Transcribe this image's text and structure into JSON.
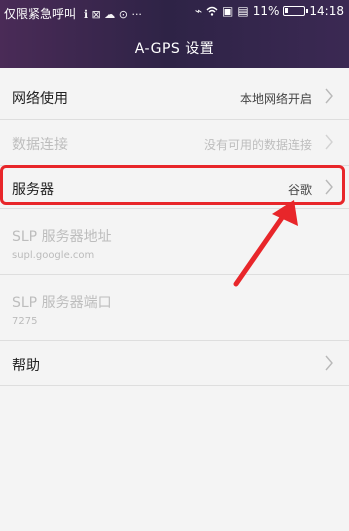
{
  "statusbar": {
    "carrier": "仅限紧急呼叫",
    "battery_percent": "11%",
    "time": "14:18",
    "icons": [
      "sync-icon",
      "image-icon",
      "cloud-icon",
      "robot-icon",
      "more-icon",
      "vibrate-icon",
      "wifi-icon",
      "sim-icon",
      "screenshot-icon"
    ]
  },
  "header": {
    "title": "A-GPS 设置"
  },
  "rows": {
    "network": {
      "label": "网络使用",
      "value": "本地网络开启"
    },
    "data": {
      "label": "数据连接",
      "value": "没有可用的数据连接"
    },
    "server": {
      "label": "服务器",
      "value": "谷歌"
    },
    "slp_address": {
      "label": "SLP 服务器地址",
      "sub": "supl.google.com"
    },
    "slp_port": {
      "label": "SLP 服务器端口",
      "sub": "7275"
    },
    "help": {
      "label": "帮助"
    }
  },
  "colors": {
    "highlight": "#e8262a",
    "header_start": "#4a2b57",
    "header_end": "#2e2346"
  }
}
